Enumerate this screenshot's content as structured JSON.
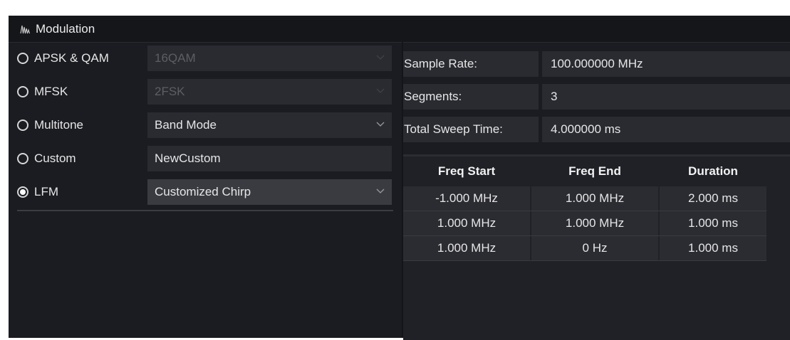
{
  "window": {
    "title": "Modulation",
    "icon": "chirp-waveform-icon"
  },
  "modulation_types": [
    {
      "label": "APSK & QAM",
      "selected": false,
      "dropdown": "16QAM",
      "enabled": false,
      "control": "dropdown"
    },
    {
      "label": "MFSK",
      "selected": false,
      "dropdown": "2FSK",
      "enabled": false,
      "control": "dropdown"
    },
    {
      "label": "Multitone",
      "selected": false,
      "dropdown": "Band Mode",
      "enabled": true,
      "control": "dropdown"
    },
    {
      "label": "Custom",
      "selected": false,
      "dropdown": "NewCustom",
      "enabled": true,
      "control": "text"
    },
    {
      "label": "LFM",
      "selected": true,
      "dropdown": "Customized Chirp",
      "enabled": true,
      "control": "dropdown"
    }
  ],
  "info": {
    "sample_rate_label": "Sample Rate:",
    "sample_rate_value": "100.000000 MHz",
    "segments_label": "Segments:",
    "segments_value": "3",
    "sweep_time_label": "Total Sweep Time:",
    "sweep_time_value": "4.000000 ms"
  },
  "table": {
    "headers": [
      "Freq Start",
      "Freq End",
      "Duration"
    ],
    "rows": [
      [
        "-1.000 MHz",
        "1.000 MHz",
        "2.000 ms"
      ],
      [
        "1.000 MHz",
        "1.000 MHz",
        "1.000 ms"
      ],
      [
        "1.000 MHz",
        "0 Hz",
        "1.000 ms"
      ]
    ]
  },
  "colors": {
    "panel_bg": "#1b1c21",
    "field_bg": "#2a2b31",
    "text": "#e6e6e6",
    "disabled_text": "#5d5e64"
  }
}
